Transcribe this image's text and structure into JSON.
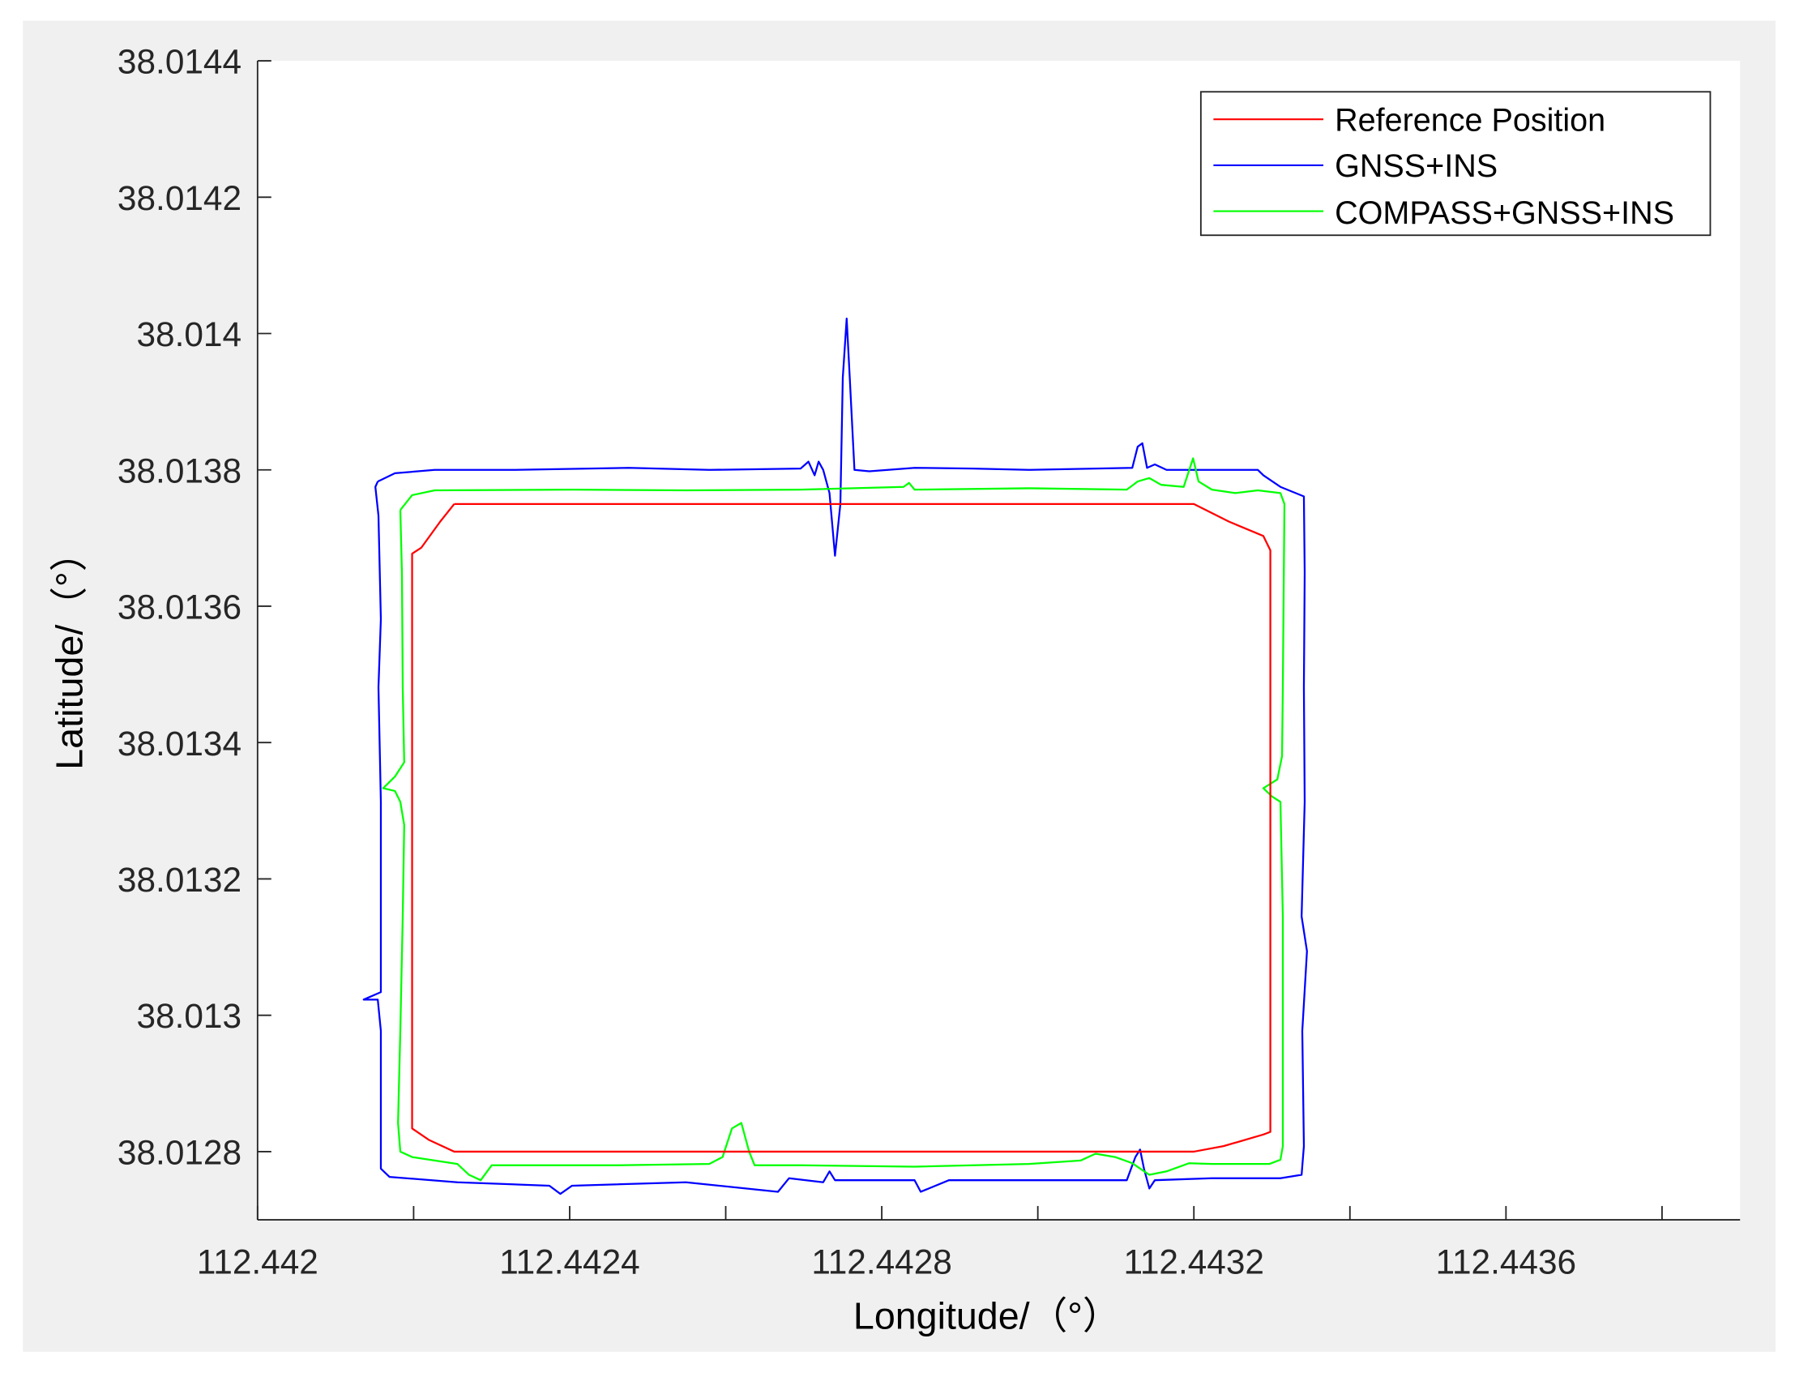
{
  "chart_data": {
    "type": "line",
    "title": "",
    "xlabel": "Longitude/（°）",
    "ylabel": "Latitude/（°）",
    "xlim": [
      112.442,
      112.4439
    ],
    "ylim": [
      38.0127,
      38.0144
    ],
    "grid": false,
    "legend_position": "top-right",
    "x_ticks": [
      112.442,
      112.4422,
      112.4424,
      112.4426,
      112.4428,
      112.443,
      112.4432,
      112.4434,
      112.4436,
      112.4438
    ],
    "x_tick_labels": [
      "112.442",
      "",
      "112.4424",
      "",
      "112.4428",
      "",
      "112.4432",
      "",
      "112.4436",
      ""
    ],
    "y_ticks": [
      38.0128,
      38.013,
      38.0132,
      38.0134,
      38.0136,
      38.0138,
      38.014,
      38.0142,
      38.0144
    ],
    "y_tick_labels": [
      "38.0128",
      "38.013",
      "38.0132",
      "38.0134",
      "38.0136",
      "38.0138",
      "38.014",
      "38.0142",
      "38.0144"
    ],
    "series": [
      {
        "name": "Reference Position",
        "color": "#ff0000",
        "lon": [
          112.442252,
          112.4432,
          112.443245,
          112.443289,
          112.443298,
          112.443298,
          112.443289,
          112.443238,
          112.4432,
          112.442252,
          112.44222,
          112.442198,
          112.442198,
          112.44221,
          112.442234,
          112.442252
        ],
        "lat": [
          38.01375,
          38.01375,
          38.013724,
          38.013703,
          38.013682,
          38.012829,
          38.012825,
          38.012808,
          38.0128,
          38.0128,
          38.012817,
          38.012834,
          38.013677,
          38.013686,
          38.013724,
          38.01375
        ]
      },
      {
        "name": "GNSS+INS",
        "color": "#0000ff",
        "lon": [
          112.442154,
          112.442176,
          112.442227,
          112.44233,
          112.442476,
          112.442579,
          112.442696,
          112.442706,
          112.442714,
          112.442719,
          112.442725,
          112.442733,
          112.44274,
          112.442747,
          112.44275,
          112.442755,
          112.442759,
          112.442765,
          112.442784,
          112.442842,
          112.442916,
          112.442989,
          112.443121,
          112.443128,
          112.443134,
          112.44314,
          112.44315,
          112.443165,
          112.443282,
          112.443289,
          112.443311,
          112.443341,
          112.443342,
          112.443341,
          112.443342,
          112.443338,
          112.443345,
          112.443339,
          112.443341,
          112.443338,
          112.443311,
          112.443223,
          112.44315,
          112.443143,
          112.443136,
          112.443131,
          112.443125,
          112.443114,
          112.442989,
          112.442886,
          112.44285,
          112.442842,
          112.44274,
          112.442733,
          112.442725,
          112.442681,
          112.442667,
          112.442549,
          112.442403,
          112.442388,
          112.442374,
          112.442256,
          112.442169,
          112.442158,
          112.442158,
          112.442154,
          112.442136,
          112.442158,
          112.442158,
          112.442158,
          112.442155,
          112.442158,
          112.442155,
          112.442151,
          112.442154
        ],
        "lat": [
          38.013783,
          38.013795,
          38.0138,
          38.0138,
          38.013803,
          38.0138,
          38.013802,
          38.013812,
          38.013792,
          38.013812,
          38.0138,
          38.013766,
          38.013674,
          38.01375,
          38.013935,
          38.014022,
          38.013935,
          38.0138,
          38.013798,
          38.013803,
          38.013802,
          38.0138,
          38.013803,
          38.013834,
          38.013839,
          38.013803,
          38.013808,
          38.0138,
          38.0138,
          38.013792,
          38.013775,
          38.013761,
          38.013649,
          38.013481,
          38.013313,
          38.013145,
          38.013094,
          38.012977,
          38.012808,
          38.012766,
          38.012761,
          38.012761,
          38.012758,
          38.012746,
          38.012775,
          38.012803,
          38.012792,
          38.012758,
          38.012758,
          38.012758,
          38.012741,
          38.012758,
          38.012758,
          38.012771,
          38.012755,
          38.012761,
          38.012741,
          38.012755,
          38.01275,
          38.012738,
          38.01275,
          38.012755,
          38.012763,
          38.012775,
          38.012977,
          38.013023,
          38.013023,
          38.013034,
          38.013145,
          38.013313,
          38.013481,
          38.013581,
          38.013733,
          38.013775,
          38.013783
        ]
      },
      {
        "name": "COMPASS+GNSS+INS",
        "color": "#00ff00",
        "lon": [
          112.442183,
          112.442198,
          112.442227,
          112.442403,
          112.442549,
          112.442696,
          112.442828,
          112.442835,
          112.442842,
          112.442989,
          112.443114,
          112.443128,
          112.443143,
          112.443158,
          112.443187,
          112.443199,
          112.443206,
          112.443223,
          112.443253,
          112.443282,
          112.443311,
          112.443316,
          112.443314,
          112.443313,
          112.443307,
          112.443289,
          112.4433,
          112.443311,
          112.443314,
          112.443314,
          112.443311,
          112.443297,
          112.443223,
          112.443194,
          112.443165,
          112.443143,
          112.443121,
          112.443099,
          112.443074,
          112.443055,
          112.442989,
          112.442842,
          112.442696,
          112.442637,
          112.44263,
          112.44262,
          112.442608,
          112.442596,
          112.442579,
          112.442462,
          112.4423,
          112.442286,
          112.442271,
          112.442256,
          112.442198,
          112.442183,
          112.44218,
          112.442183,
          112.442186,
          112.442188,
          112.442183,
          112.442176,
          112.442161,
          112.442176,
          112.442188,
          112.442186,
          112.442185,
          112.442183
        ],
        "lat": [
          38.013741,
          38.013763,
          38.01377,
          38.013771,
          38.01377,
          38.013771,
          38.013775,
          38.013781,
          38.013771,
          38.013773,
          38.013771,
          38.013783,
          38.013788,
          38.013778,
          38.013775,
          38.013817,
          38.013783,
          38.013771,
          38.013766,
          38.01377,
          38.013766,
          38.01375,
          38.013481,
          38.01338,
          38.013346,
          38.013333,
          38.013321,
          38.013313,
          38.013145,
          38.012808,
          38.012788,
          38.012782,
          38.012782,
          38.012783,
          38.012771,
          38.012766,
          38.012783,
          38.012792,
          38.012797,
          38.012787,
          38.012782,
          38.012778,
          38.01278,
          38.01278,
          38.0128,
          38.012842,
          38.012834,
          38.012792,
          38.012782,
          38.01278,
          38.01278,
          38.012758,
          38.012766,
          38.012782,
          38.012792,
          38.0128,
          38.012842,
          38.012977,
          38.013145,
          38.013279,
          38.013313,
          38.013329,
          38.013333,
          38.01335,
          38.013371,
          38.013481,
          38.013649,
          38.013741
        ]
      }
    ]
  }
}
